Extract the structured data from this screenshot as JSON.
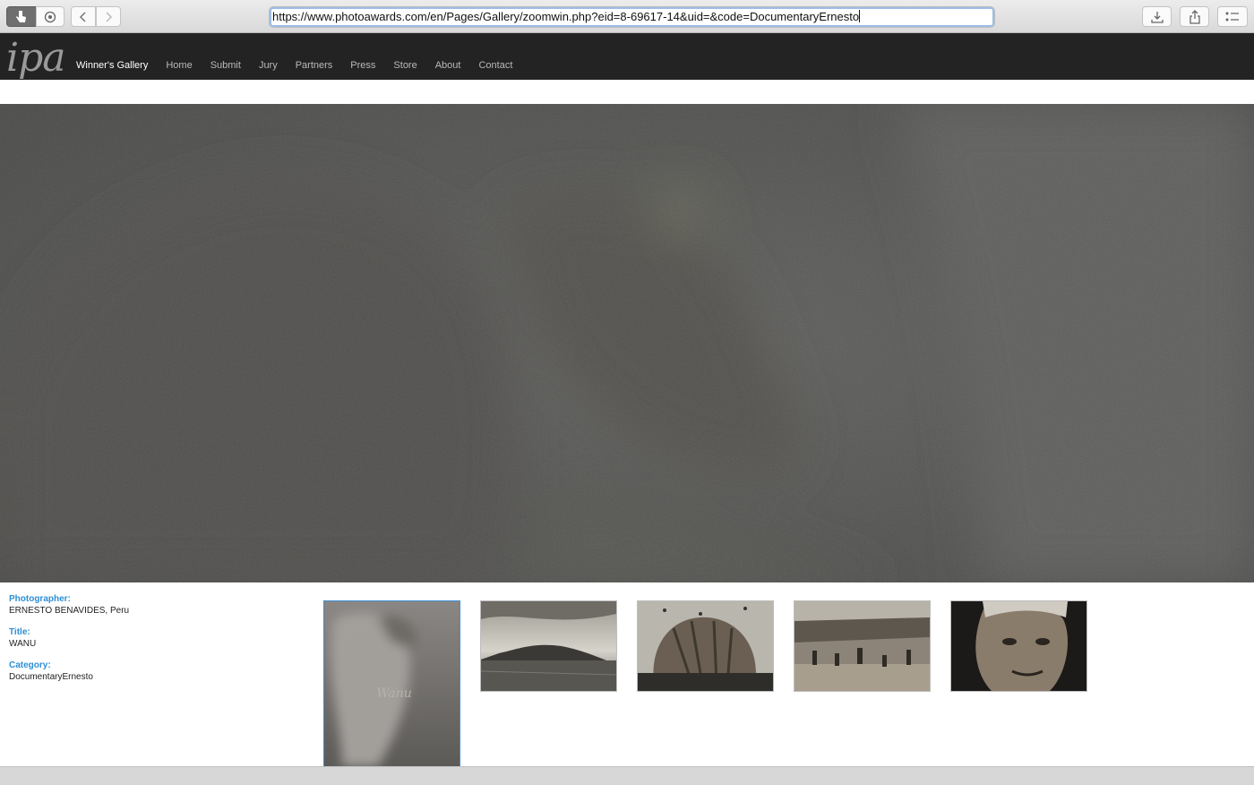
{
  "browser": {
    "url": "https://www.photoawards.com/en/Pages/Gallery/zoomwin.php?eid=8-69617-14&uid=&code=DocumentaryErnesto",
    "icons": [
      "pointer-icon",
      "screenshot-icon",
      "back-icon",
      "forward-icon",
      "download-icon",
      "share-icon",
      "reading-list-icon"
    ]
  },
  "site": {
    "logo": "ipa",
    "nav": [
      {
        "label": "Winner's Gallery",
        "active": true
      },
      {
        "label": "Home"
      },
      {
        "label": "Submit"
      },
      {
        "label": "Jury"
      },
      {
        "label": "Partners"
      },
      {
        "label": "Press"
      },
      {
        "label": "Store"
      },
      {
        "label": "About"
      },
      {
        "label": "Contact"
      }
    ]
  },
  "info": {
    "photographer_label": "Photographer:",
    "photographer": "ERNESTO BENAVIDES, Peru",
    "title_label": "Title:",
    "title": "WANU",
    "category_label": "Category:",
    "category": "DocumentaryErnesto"
  },
  "thumbnails": {
    "selected_caption": "Wanu",
    "items": [
      "thumbnail-wanu-cover",
      "thumbnail-island",
      "thumbnail-guano-sack",
      "thumbnail-workers",
      "thumbnail-portrait"
    ]
  },
  "colors": {
    "accent": "#2d8fd6",
    "header_bg": "#232323",
    "selected_border": "#3b8fd6"
  }
}
